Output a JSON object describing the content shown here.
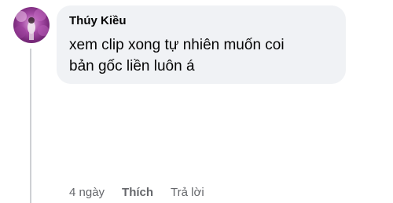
{
  "comment": {
    "author": "Thúy Kiều",
    "text_line1": "xem clip xong tự nhiên muốn coi",
    "text_line2": "bản gốc liền luôn á",
    "time": "4 ngày",
    "like_label": "Thích",
    "reply_label": "Trả lời"
  },
  "colors": {
    "bubble_bg": "#f0f2f5",
    "secondary_text": "#65676b",
    "thread_line": "#ced0d4"
  },
  "icons": {
    "avatar": "profile-photo"
  }
}
